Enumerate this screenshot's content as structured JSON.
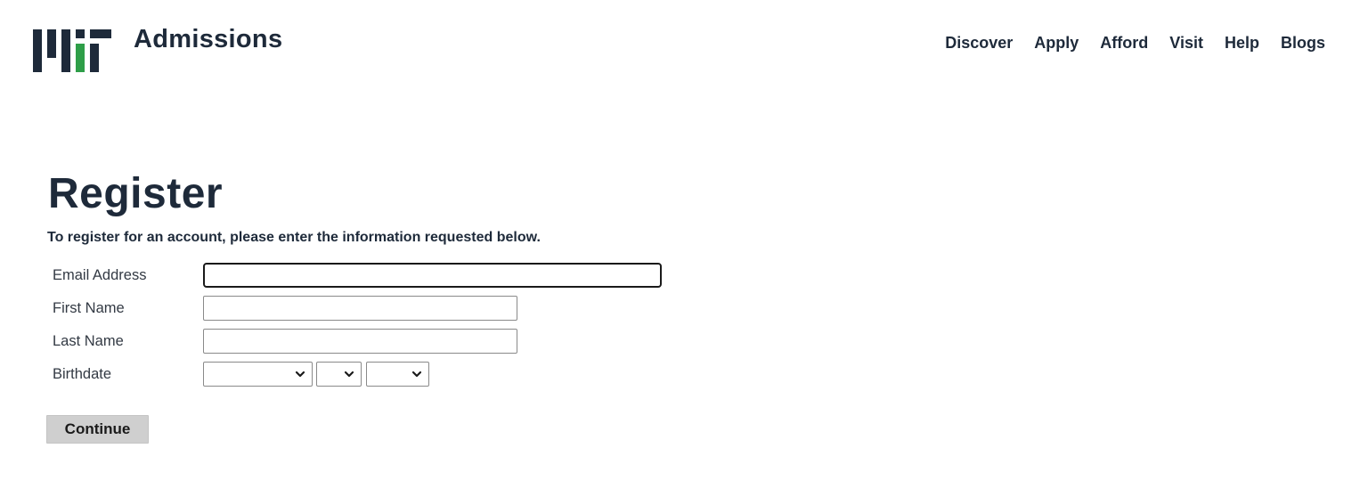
{
  "header": {
    "logo_icon": "mit-logo",
    "logo_accent_color": "#2e9e48",
    "title": "Admissions",
    "nav": [
      {
        "label": "Discover"
      },
      {
        "label": "Apply"
      },
      {
        "label": "Afford"
      },
      {
        "label": "Visit"
      },
      {
        "label": "Help"
      },
      {
        "label": "Blogs"
      }
    ]
  },
  "main": {
    "title": "Register",
    "intro": "To register for an account, please enter the information requested below.",
    "form": {
      "email": {
        "label": "Email Address",
        "value": ""
      },
      "first_name": {
        "label": "First Name",
        "value": ""
      },
      "last_name": {
        "label": "Last Name",
        "value": ""
      },
      "birthdate": {
        "label": "Birthdate",
        "month": "",
        "day": "",
        "year": "",
        "dropdown_icon": "chevron-down-icon"
      },
      "submit_label": "Continue"
    }
  },
  "colors": {
    "text": "#1e2a3a",
    "button_bg": "#cfcfcf",
    "logo_green": "#2e9e48"
  }
}
